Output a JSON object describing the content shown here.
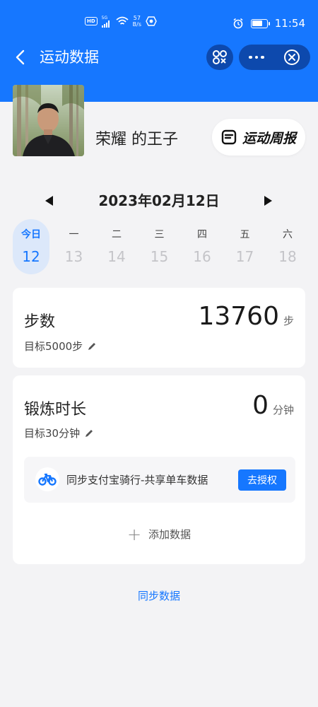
{
  "status_bar": {
    "network_label": "HD",
    "signal_label": "5G",
    "speed_value": "57",
    "speed_unit": "B/s",
    "time": "11:54",
    "battery_level": 0.75
  },
  "nav": {
    "title": "运动数据",
    "back_icon": "chevron-left-icon",
    "scan_icon": "mini-program-icon",
    "more_icon": "more-dots-icon",
    "close_icon": "close-circle-icon"
  },
  "profile": {
    "username": "荣耀 的王子",
    "weekly_report_label": "运动周报"
  },
  "date_nav": {
    "current_date": "2023年02月12日"
  },
  "week": [
    {
      "name": "今日",
      "day": "12",
      "active": true
    },
    {
      "name": "一",
      "day": "13",
      "active": false
    },
    {
      "name": "二",
      "day": "14",
      "active": false
    },
    {
      "name": "三",
      "day": "15",
      "active": false
    },
    {
      "name": "四",
      "day": "16",
      "active": false
    },
    {
      "name": "五",
      "day": "17",
      "active": false
    },
    {
      "name": "六",
      "day": "18",
      "active": false
    }
  ],
  "steps_card": {
    "title": "步数",
    "goal": "目标5000步",
    "value": "13760",
    "unit": "步"
  },
  "exercise_card": {
    "title": "锻炼时长",
    "goal": "目标30分钟",
    "value": "0",
    "unit": "分钟",
    "auth_text": "同步支付宝骑行-共享单车数据",
    "auth_button": "去授权",
    "add_label": "添加数据"
  },
  "sync_label": "同步数据",
  "colors": {
    "primary": "#1677ff",
    "background": "#f3f3f5",
    "selected_day_bg": "#dce8fa"
  }
}
